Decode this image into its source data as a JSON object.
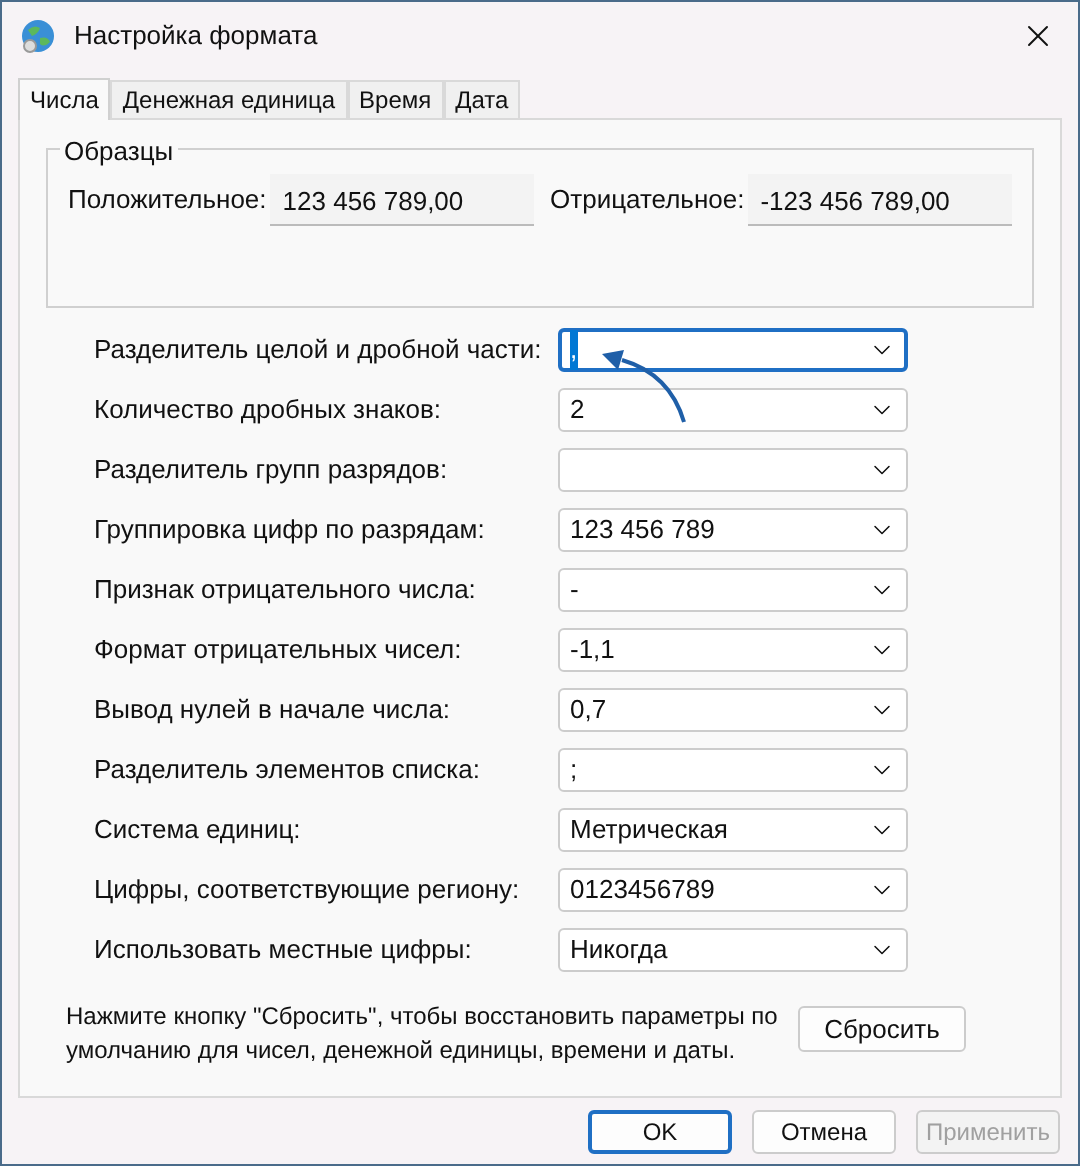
{
  "window": {
    "title": "Настройка формата"
  },
  "tabs": [
    {
      "label": "Числа",
      "selected": true
    },
    {
      "label": "Денежная единица",
      "selected": false
    },
    {
      "label": "Время",
      "selected": false
    },
    {
      "label": "Дата",
      "selected": false
    }
  ],
  "samples": {
    "title": "Образцы",
    "positive_label": "Положительное:",
    "positive_value": "123 456 789,00",
    "negative_label": "Отрицательное:",
    "negative_value": "-123 456 789,00"
  },
  "settings": [
    {
      "label": "Разделитель целой и дробной части:",
      "value": ",",
      "focused": true
    },
    {
      "label": "Количество дробных знаков:",
      "value": "2",
      "focused": false
    },
    {
      "label": "Разделитель групп разрядов:",
      "focused": false
    },
    {
      "label": "Группировка цифр по разрядам:",
      "value": "123 456 789",
      "focused": false
    },
    {
      "label": "Признак отрицательного числа:",
      "value": "-",
      "focused": false
    },
    {
      "label": "Формат отрицательных чисел:",
      "value": "-1,1",
      "focused": false
    },
    {
      "label": "Вывод нулей в начале числа:",
      "value": "0,7",
      "focused": false
    },
    {
      "label": "Разделитель элементов списка:",
      "value": ";",
      "focused": false
    },
    {
      "label": "Система единиц:",
      "value": "Метрическая",
      "focused": false
    },
    {
      "label": "Цифры, соответствующие региону:",
      "value": "0123456789",
      "focused": false
    },
    {
      "label": "Использовать местные цифры:",
      "value": "Никогда",
      "focused": false
    }
  ],
  "reset_note": "Нажмите кнопку \"Сбросить\", чтобы восстановить параметры по умолчанию для чисел, денежной единицы, времени и даты.",
  "reset_button": "Сбросить",
  "buttons": [
    {
      "label": "OK",
      "kind": "default",
      "disabled": false
    },
    {
      "label": "Отмена",
      "kind": "normal",
      "disabled": false
    },
    {
      "label": "Применить",
      "kind": "normal",
      "disabled": true
    }
  ]
}
